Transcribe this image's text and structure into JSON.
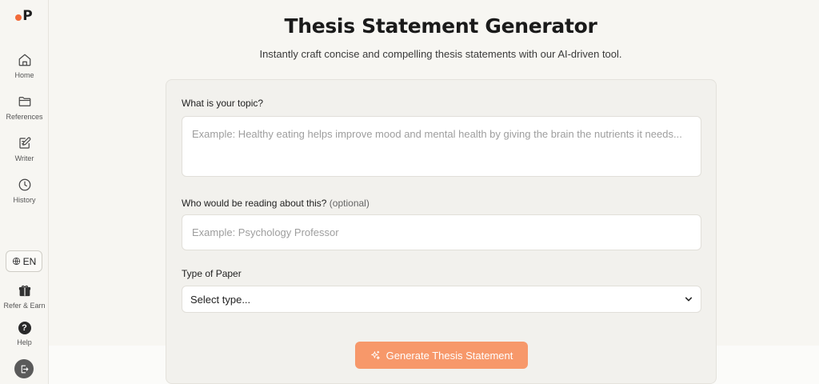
{
  "sidebar": {
    "logo_text": "P",
    "nav": [
      {
        "label": "Home",
        "icon": "home-icon"
      },
      {
        "label": "References",
        "icon": "folder-icon"
      },
      {
        "label": "Writer",
        "icon": "edit-icon"
      },
      {
        "label": "History",
        "icon": "clock-icon"
      }
    ],
    "language": "EN",
    "refer_label": "Refer & Earn",
    "help_label": "Help",
    "help_glyph": "?"
  },
  "main": {
    "title": "Thesis Statement Generator",
    "subtitle": "Instantly craft concise and compelling thesis statements with our AI-driven tool."
  },
  "form": {
    "topic_label": "What is your topic?",
    "topic_placeholder": "Example: Healthy eating helps improve mood and mental health by giving the brain the nutrients it needs...",
    "audience_label": "Who would be reading about this?",
    "audience_optional": "(optional)",
    "audience_placeholder": "Example: Psychology Professor",
    "paper_type_label": "Type of Paper",
    "paper_type_value": "Select type...",
    "generate_label": "Generate Thesis Statement"
  },
  "colors": {
    "accent": "#f7986a",
    "logo_dot": "#f26b3a",
    "background": "#f7f6f2"
  }
}
